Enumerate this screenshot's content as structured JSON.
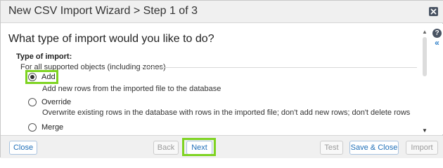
{
  "window": {
    "title": "New CSV Import Wizard > Step 1 of 3"
  },
  "content": {
    "question": "What type of import would you like to do?",
    "type_label": "Type of import:",
    "scope_label": "For all supported objects (including zones)",
    "options": [
      {
        "label": "Add",
        "description": "Add new rows from the imported file to the database",
        "selected": true
      },
      {
        "label": "Override",
        "description": "Overwrite existing rows in the database with rows in the imported file; don't add new rows; don't delete rows",
        "selected": false
      },
      {
        "label": "Merge",
        "description": "",
        "selected": false
      }
    ]
  },
  "side_tools": {
    "help_glyph": "?",
    "collapse_glyph": "«"
  },
  "footer": {
    "close_label": "Close",
    "back_label": "Back",
    "next_label": "Next",
    "test_label": "Test",
    "save_close_label": "Save & Close",
    "import_label": "Import"
  },
  "colors": {
    "highlight": "#7ed321",
    "primary_text": "#1f6fb8",
    "titlebar_bg": "#f0f0f0"
  }
}
